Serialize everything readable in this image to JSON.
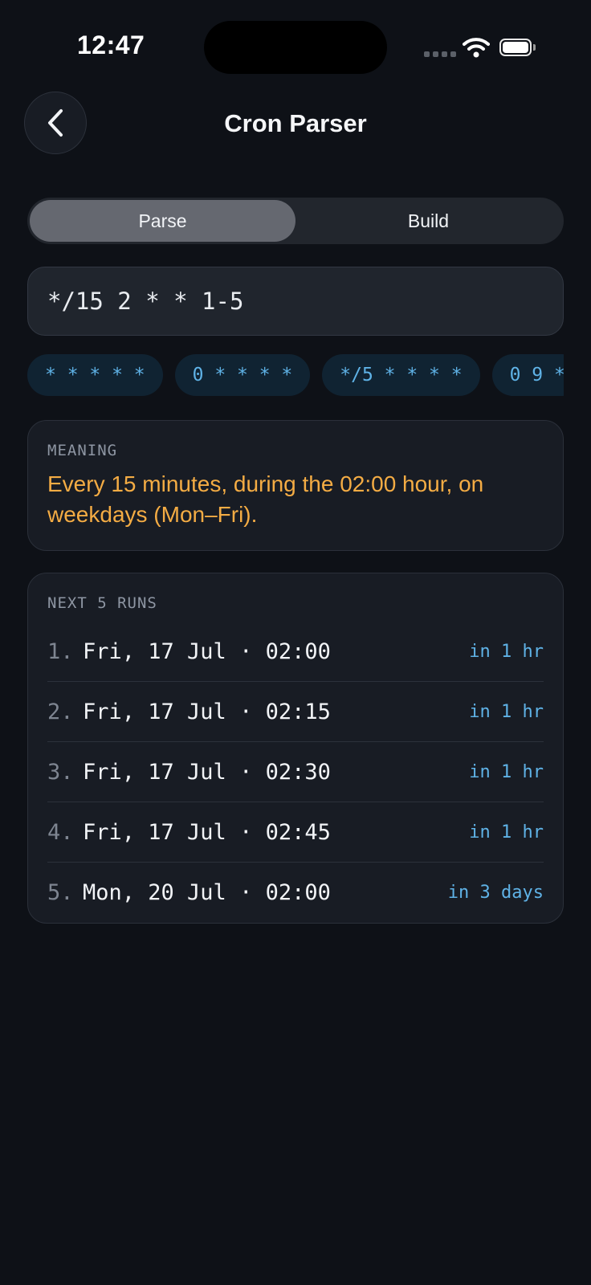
{
  "status_bar": {
    "time": "12:47"
  },
  "header": {
    "title": "Cron Parser",
    "back_icon": "chevron-left-icon"
  },
  "tabs": [
    {
      "label": "Parse",
      "active": true
    },
    {
      "label": "Build",
      "active": false
    }
  ],
  "expression": {
    "value": "*/15 2 * * 1-5"
  },
  "presets": [
    "* * * * *",
    "0 * * * *",
    "*/5 * * * *",
    "0 9 *"
  ],
  "meaning": {
    "label": "MEANING",
    "text": "Every 15 minutes, during the 02:00 hour, on weekdays (Mon–Fri)."
  },
  "next_runs": {
    "label": "NEXT 5 RUNS",
    "items": [
      {
        "num": "1.",
        "date": "Fri, 17 Jul · 02:00",
        "relative": "in 1 hr"
      },
      {
        "num": "2.",
        "date": "Fri, 17 Jul · 02:15",
        "relative": "in 1 hr"
      },
      {
        "num": "3.",
        "date": "Fri, 17 Jul · 02:30",
        "relative": "in 1 hr"
      },
      {
        "num": "4.",
        "date": "Fri, 17 Jul · 02:45",
        "relative": "in 1 hr"
      },
      {
        "num": "5.",
        "date": "Mon, 20 Jul · 02:00",
        "relative": "in 3 days"
      }
    ]
  },
  "colors": {
    "background": "#0e1117",
    "accent_orange": "#f4ac44",
    "accent_blue": "#5fb2e6"
  }
}
